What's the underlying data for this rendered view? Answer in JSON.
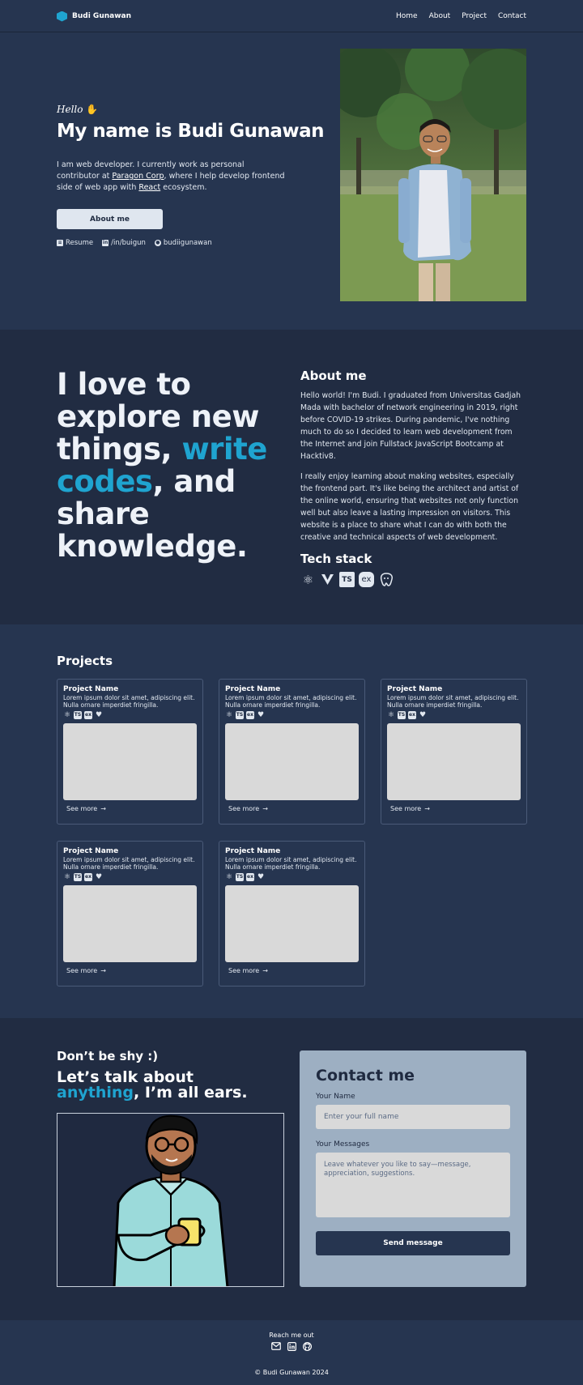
{
  "nav": {
    "brand": "Budi Gunawan",
    "links": [
      "Home",
      "About",
      "Project",
      "Contact"
    ]
  },
  "hero": {
    "greeting": "Hello",
    "title": "My name is Budi Gunawan",
    "intro_1": "I am web developer. I currently work as personal contributor at ",
    "intro_company": "Paragon Corp",
    "intro_2": ", where I help develop frontend side of web app with ",
    "intro_framework": "React",
    "intro_3": " ecosystem.",
    "about_button": "About me",
    "links": {
      "resume": "Resume",
      "linkedin": "/in/buigun",
      "github": "budiigunawan"
    }
  },
  "about": {
    "big_1": "I love to explore new things, ",
    "big_accent": "write codes",
    "big_2": ", and share knowledge.",
    "title": "About me",
    "p1": "Hello world! I'm Budi. I graduated from Universitas Gadjah Mada with bachelor of network engineering in 2019, right before COVID-19 strikes. During pandemic, I've nothing much to do so I decided to learn web development from the Internet and join Fullstack JavaScript Bootcamp at Hacktiv8.",
    "p2": "I really enjoy learning about making websites, especially the frontend part. It's like being the architect and artist of the online world, ensuring that websites not only function well but also leave a lasting impression on visitors. This website is a place to share what I can do with both the creative and technical aspects of web development.",
    "stack_title": "Tech stack",
    "stack_icons": [
      "react-icon",
      "vite-icon",
      "typescript-icon",
      "express-icon",
      "postgresql-icon"
    ]
  },
  "projects": {
    "title": "Projects",
    "items": [
      {
        "name": "Project Name",
        "desc": "Lorem ipsum dolor sit amet, adipiscing elit. Nulla ornare imperdiet fringilla.",
        "link": "See more"
      },
      {
        "name": "Project Name",
        "desc": "Lorem ipsum dolor sit amet, adipiscing elit. Nulla ornare imperdiet fringilla.",
        "link": "See more"
      },
      {
        "name": "Project Name",
        "desc": "Lorem ipsum dolor sit amet, adipiscing elit. Nulla ornare imperdiet fringilla.",
        "link": "See more"
      },
      {
        "name": "Project Name",
        "desc": "Lorem ipsum dolor sit amet, adipiscing elit. Nulla ornare imperdiet fringilla.",
        "link": "See more"
      },
      {
        "name": "Project Name",
        "desc": "Lorem ipsum dolor sit amet, adipiscing elit. Nulla ornare imperdiet fringilla.",
        "link": "See more"
      }
    ]
  },
  "contact": {
    "shy": "Don’t be shy :)",
    "talk_1": "Let’s talk about ",
    "talk_accent": "anything",
    "talk_2": ", I’m all ears.",
    "form_title": "Contact me",
    "name_label": "Your Name",
    "name_placeholder": "Enter your full name",
    "message_label": "Your Messages",
    "message_placeholder": "Leave whatever you like to say—message, appreciation, suggestions.",
    "send_button": "Send message"
  },
  "footer": {
    "reach": "Reach me out",
    "copyright": "© Budi Gunawan 2024"
  },
  "colors": {
    "accent": "#1fa4d0",
    "navy": "#263550",
    "navy_dark": "#212c42",
    "form_bg": "#9dafc2"
  }
}
